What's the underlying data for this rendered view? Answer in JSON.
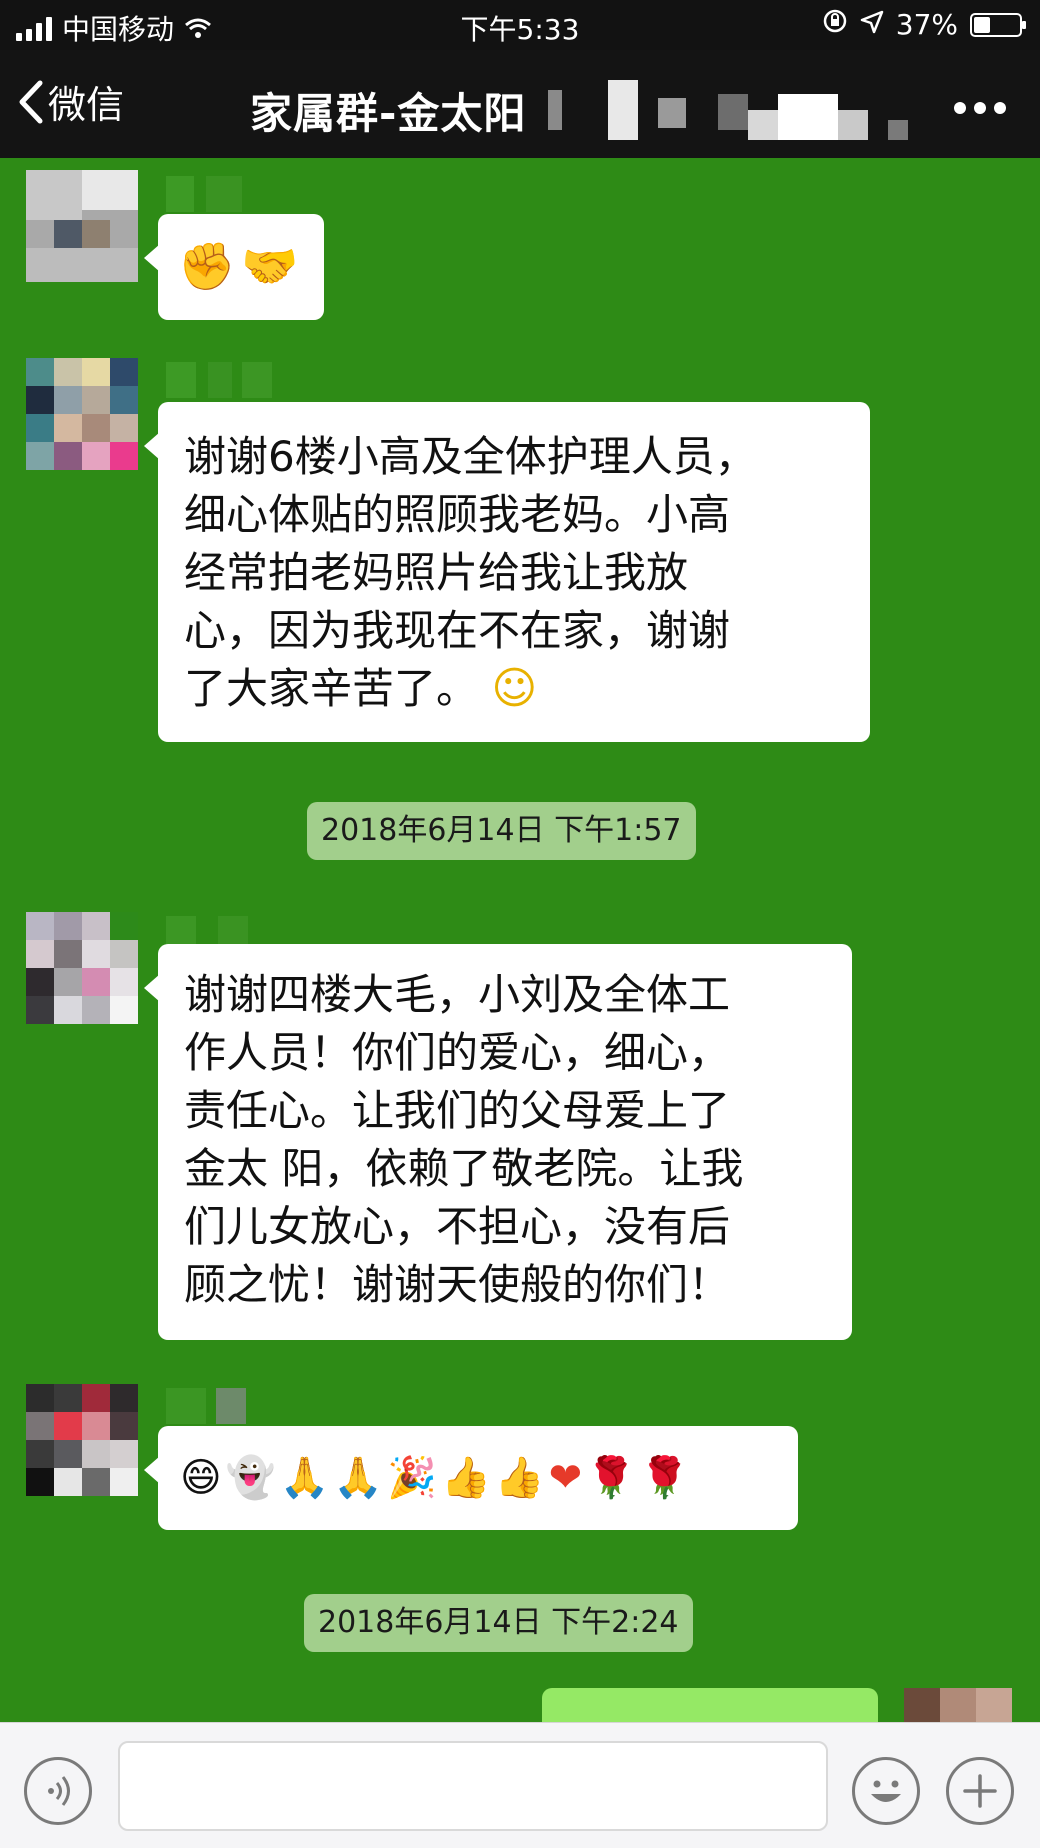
{
  "status_bar": {
    "carrier": "中国移动",
    "time": "下午5:33",
    "battery": "37%",
    "battery_level": 0.37
  },
  "nav": {
    "back_label": "微信",
    "title": "家属群-金太阳",
    "more_icon": "more-dots-icon"
  },
  "messages": [
    {
      "type": "emoji",
      "emojis": [
        "✊",
        "🤝"
      ]
    },
    {
      "type": "text",
      "lines": [
        "谢谢6楼小高及全体护理人员，",
        "细心体贴的照顾我老妈。小高",
        "经常拍老妈照片给我让我放",
        "心，因为我现在不在家，谢谢",
        "了大家辛苦了。"
      ],
      "trailing_emoji": "☺"
    },
    {
      "type": "timestamp",
      "text": "2018年6月14日 下午1:57"
    },
    {
      "type": "text",
      "lines": [
        "谢谢四楼大毛，小刘及全体工",
        "作人员！你们的爱心，细心，",
        "责任心。让我们的父母爱上了",
        "金太 阳，依赖了敬老院。让我",
        "们儿女放心，不担心，没有后",
        "顾之忧！谢谢天使般的你们！"
      ]
    },
    {
      "type": "emoji",
      "emojis": [
        "😄",
        "👻",
        "🙏",
        "🙏",
        "🎉",
        "👍",
        "👍",
        "❤",
        "🌹",
        "🌹"
      ]
    },
    {
      "type": "timestamp",
      "text": "2018年6月14日 下午2:24"
    }
  ],
  "input_bar": {
    "voice_icon": "voice-icon",
    "emoji_icon": "emoji-icon",
    "plus_icon": "plus-icon"
  }
}
